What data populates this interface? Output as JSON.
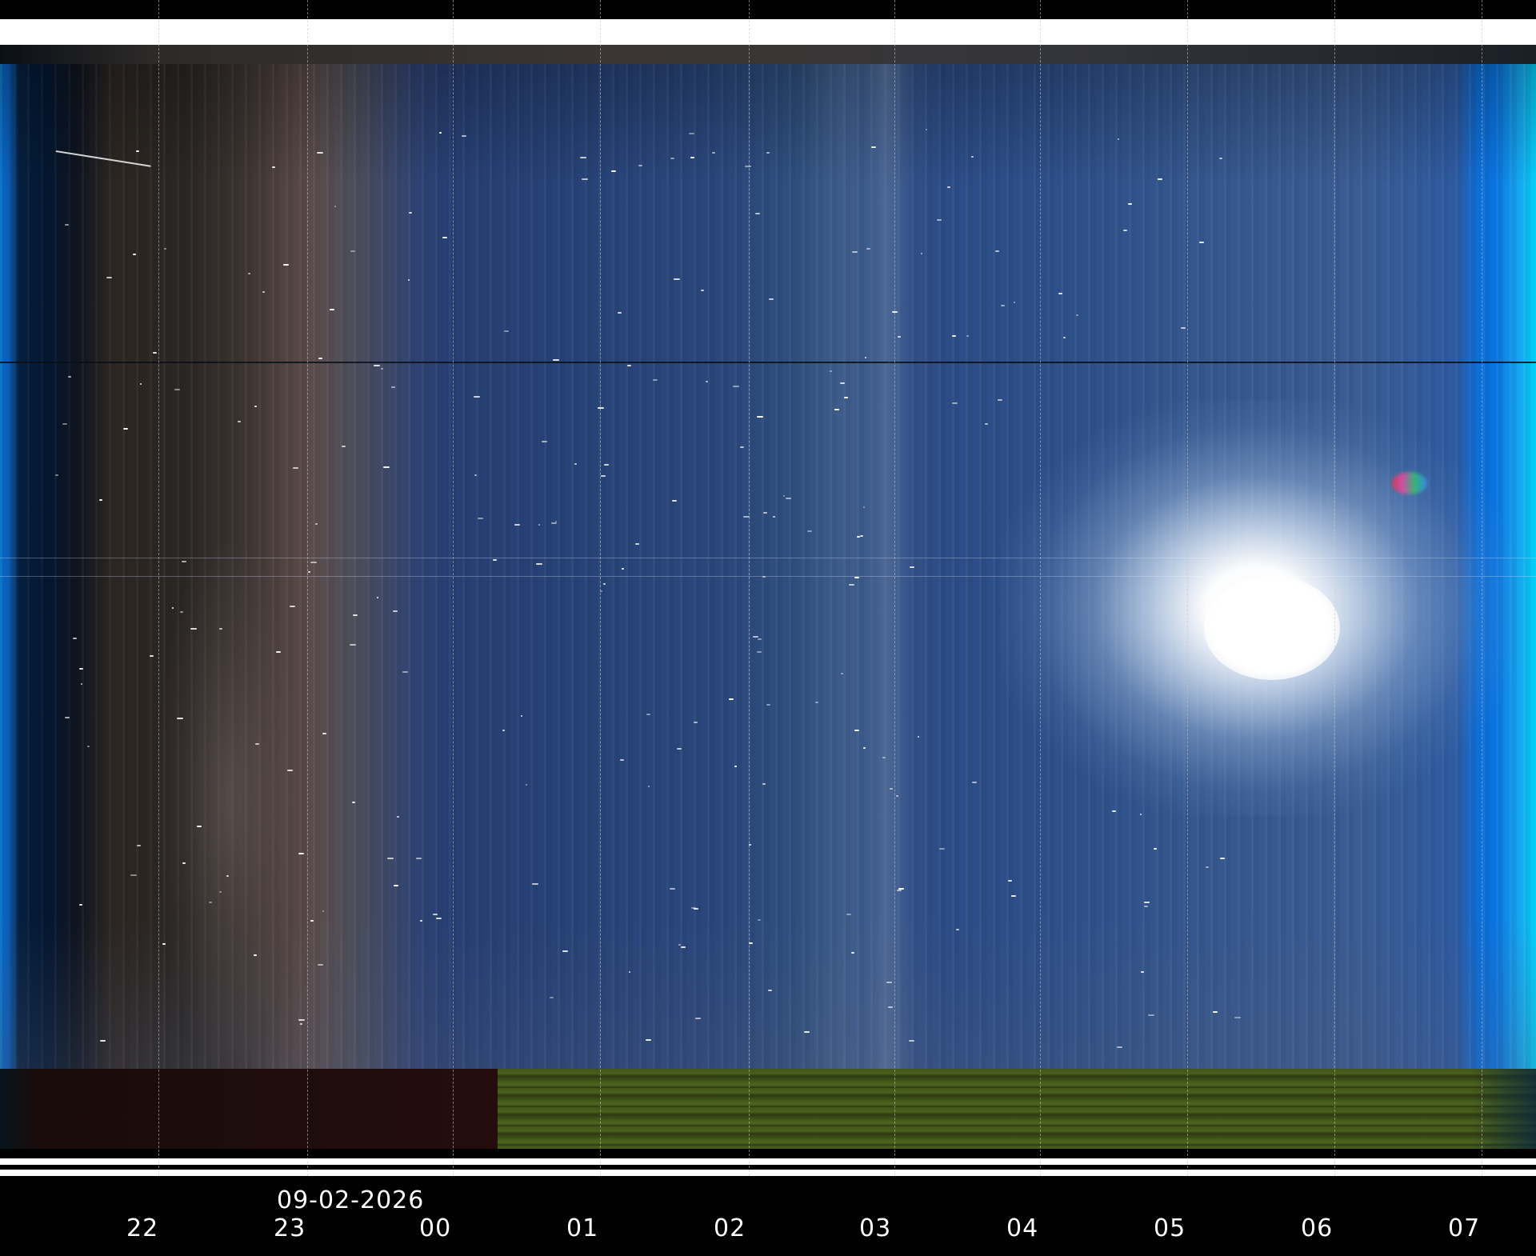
{
  "date_label": "09-02-2026",
  "hour_labels": [
    "22",
    "23",
    "00",
    "01",
    "02",
    "03",
    "04",
    "05",
    "06",
    "07"
  ],
  "colors": {
    "background": "#000000",
    "sky_blue": "#2a477c",
    "horizon_edge": "#03d2fa",
    "ground_green": "#4a5e1c",
    "sun": "#ffffff"
  }
}
